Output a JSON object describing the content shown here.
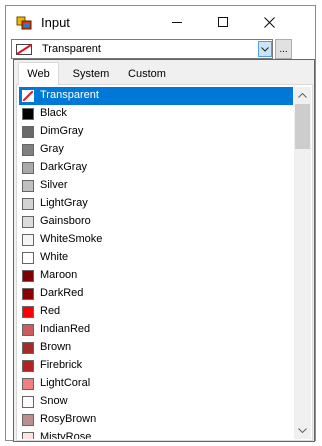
{
  "window": {
    "title": "Input"
  },
  "combo": {
    "value": "Transparent",
    "ellipsis_label": "..."
  },
  "tabs": [
    {
      "label": "Web",
      "active": true
    },
    {
      "label": "System",
      "active": false
    },
    {
      "label": "Custom",
      "active": false
    }
  ],
  "colors": [
    {
      "name": "Transparent",
      "hex": "transparent",
      "selected": true
    },
    {
      "name": "Black",
      "hex": "#000000"
    },
    {
      "name": "DimGray",
      "hex": "#696969"
    },
    {
      "name": "Gray",
      "hex": "#808080"
    },
    {
      "name": "DarkGray",
      "hex": "#A9A9A9"
    },
    {
      "name": "Silver",
      "hex": "#C0C0C0"
    },
    {
      "name": "LightGray",
      "hex": "#D3D3D3"
    },
    {
      "name": "Gainsboro",
      "hex": "#DCDCDC"
    },
    {
      "name": "WhiteSmoke",
      "hex": "#F5F5F5"
    },
    {
      "name": "White",
      "hex": "#FFFFFF"
    },
    {
      "name": "Maroon",
      "hex": "#800000"
    },
    {
      "name": "DarkRed",
      "hex": "#8B0000"
    },
    {
      "name": "Red",
      "hex": "#FF0000"
    },
    {
      "name": "IndianRed",
      "hex": "#CD5C5C"
    },
    {
      "name": "Brown",
      "hex": "#A52A2A"
    },
    {
      "name": "Firebrick",
      "hex": "#B22222"
    },
    {
      "name": "LightCoral",
      "hex": "#F08080"
    },
    {
      "name": "Snow",
      "hex": "#FFFAFA"
    },
    {
      "name": "RosyBrown",
      "hex": "#BC8F8F"
    },
    {
      "name": "MistyRose",
      "hex": "#FFE4E1"
    }
  ],
  "theme": {
    "selection": "#0078d7",
    "accent_border": "#569de5"
  }
}
